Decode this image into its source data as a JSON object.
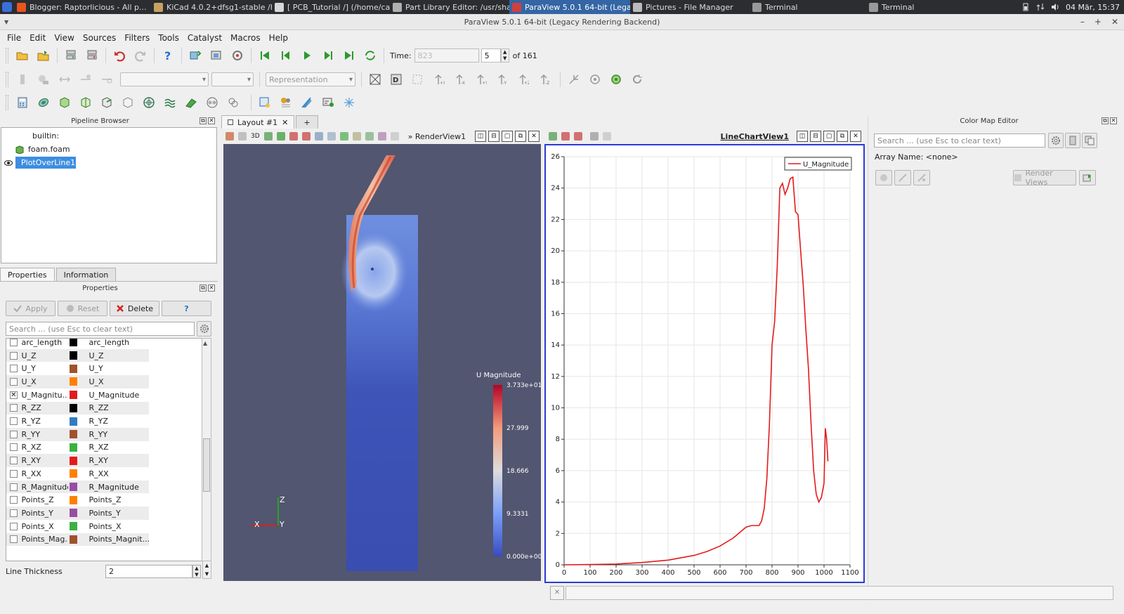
{
  "taskbar": {
    "tasks": [
      {
        "label": "Blogger: Raptorlicious - All p...",
        "color": "#e95420"
      },
      {
        "label": "KiCad 4.0.2+dfsg1-stable /ho...",
        "color": "#c8a060"
      },
      {
        "label": "[ PCB_Tutorial /] (/home/cael...",
        "color": "#d8d8d8"
      },
      {
        "label": "Part Library Editor: /usr/shar...",
        "color": "#b0b0b0"
      },
      {
        "label": "ParaView 5.0.1 64-bit (Legac...",
        "color": "#d04040"
      },
      {
        "label": "Pictures - File Manager",
        "color": "#bbbbbb"
      },
      {
        "label": "Terminal",
        "color": "#999999"
      },
      {
        "label": "Terminal",
        "color": "#999999"
      }
    ],
    "active_index": 4,
    "clock": "04 Mär, 15:37"
  },
  "window": {
    "title": "ParaView 5.0.1 64-bit (Legacy Rendering Backend)"
  },
  "menubar": [
    "File",
    "Edit",
    "View",
    "Sources",
    "Filters",
    "Tools",
    "Catalyst",
    "Macros",
    "Help"
  ],
  "time_toolbar": {
    "time_label": "Time:",
    "time_value": "823",
    "step_value": "5",
    "of_label": "of 161"
  },
  "repr_toolbar": {
    "representation": "Representation"
  },
  "pipeline_browser": {
    "title": "Pipeline Browser",
    "items": [
      {
        "label": "builtin:"
      },
      {
        "label": "foam.foam"
      },
      {
        "label": "PlotOverLine1"
      }
    ]
  },
  "properties_panel": {
    "tabs": [
      "Properties",
      "Information"
    ],
    "title": "Properties",
    "apply_label": "Apply",
    "reset_label": "Reset",
    "delete_label": "Delete",
    "help_label": "?",
    "search_placeholder": "Search ... (use Esc to clear text)",
    "rows": [
      {
        "name": "arc_length",
        "legend": "arc_length",
        "color": "#000000",
        "checked": false
      },
      {
        "name": "U_Z",
        "legend": "U_Z",
        "color": "#000000",
        "checked": false
      },
      {
        "name": "U_Y",
        "legend": "U_Y",
        "color": "#a0522d",
        "checked": false
      },
      {
        "name": "U_X",
        "legend": "U_X",
        "color": "#ff8000",
        "checked": false
      },
      {
        "name": "U_Magnitu...",
        "legend": "U_Magnitude",
        "color": "#e31a1c",
        "checked": true
      },
      {
        "name": "R_ZZ",
        "legend": "R_ZZ",
        "color": "#000000",
        "checked": false
      },
      {
        "name": "R_YZ",
        "legend": "R_YZ",
        "color": "#2f7dc0",
        "checked": false
      },
      {
        "name": "R_YY",
        "legend": "R_YY",
        "color": "#a0522d",
        "checked": false
      },
      {
        "name": "R_XZ",
        "legend": "R_XZ",
        "color": "#3cb043",
        "checked": false
      },
      {
        "name": "R_XY",
        "legend": "R_XY",
        "color": "#e31a1c",
        "checked": false
      },
      {
        "name": "R_XX",
        "legend": "R_XX",
        "color": "#ff8000",
        "checked": false
      },
      {
        "name": "R_Magnitude",
        "legend": "R_Magnitude",
        "color": "#984ea3",
        "checked": false
      },
      {
        "name": "Points_Z",
        "legend": "Points_Z",
        "color": "#ff8000",
        "checked": false
      },
      {
        "name": "Points_Y",
        "legend": "Points_Y",
        "color": "#984ea3",
        "checked": false
      },
      {
        "name": "Points_X",
        "legend": "Points_X",
        "color": "#3cb043",
        "checked": false
      },
      {
        "name": "Points_Mag...",
        "legend": "Points_Magnit...",
        "color": "#a0522d",
        "checked": false
      }
    ],
    "line_thickness_label": "Line Thickness",
    "line_thickness_value": "2"
  },
  "layout": {
    "tab_label": "Layout #1",
    "add_label": "+",
    "render_view_label": "RenderView1",
    "chart_view_label": "LineChartView1",
    "btn_3d": "3D"
  },
  "render_view": {
    "colorbar_title": "U Magnitude",
    "colorbar_ticks": [
      "3.733e+01",
      "27.999",
      "18.666",
      "9.3331",
      "0.000e+00"
    ],
    "axes": {
      "x": "X",
      "y": "Y",
      "z": "Z"
    }
  },
  "color_map_editor": {
    "title": "Color Map Editor",
    "search_placeholder": "Search ... (use Esc to clear text)",
    "array_name": "Array Name: <none>",
    "render_views_label": "Render Views"
  },
  "chart_data": {
    "type": "line",
    "title": "",
    "xlabel": "",
    "ylabel": "",
    "xlim": [
      0,
      1100
    ],
    "ylim": [
      0,
      26
    ],
    "xticks": [
      0,
      100,
      200,
      300,
      400,
      500,
      600,
      700,
      800,
      900,
      1000,
      1100
    ],
    "yticks": [
      0,
      2,
      4,
      6,
      8,
      10,
      12,
      14,
      16,
      18,
      20,
      22,
      24,
      26
    ],
    "grid": true,
    "legend_position": "top-right",
    "series": [
      {
        "name": "U_Magnitude",
        "color": "#e31a1c",
        "x": [
          0,
          100,
          200,
          300,
          400,
          500,
          550,
          600,
          650,
          700,
          720,
          750,
          760,
          770,
          780,
          790,
          800,
          810,
          820,
          830,
          840,
          850,
          860,
          870,
          880,
          890,
          900,
          910,
          920,
          930,
          940,
          950,
          960,
          970,
          980,
          990,
          1000,
          1005,
          1010,
          1015
        ],
        "y": [
          0,
          0.02,
          0.05,
          0.15,
          0.3,
          0.6,
          0.85,
          1.2,
          1.7,
          2.4,
          2.5,
          2.5,
          2.8,
          3.6,
          5.5,
          9,
          14,
          15.5,
          19,
          24,
          24.3,
          23.6,
          24,
          24.6,
          24.7,
          22.5,
          22.3,
          20,
          17.8,
          15,
          12.5,
          9,
          6,
          4.5,
          4,
          4.3,
          5.2,
          8.7,
          8,
          6.6
        ]
      }
    ]
  }
}
